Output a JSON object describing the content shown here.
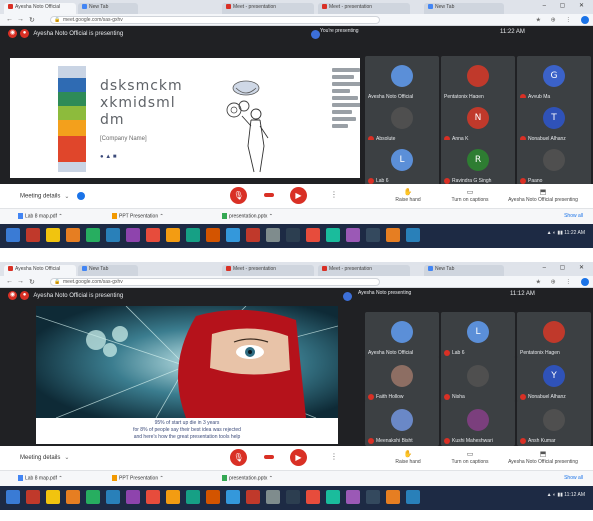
{
  "shots": [
    {
      "tabs": [
        {
          "label": "Ayesha Noto Official",
          "color": "#d93025"
        },
        {
          "label": "New Tab",
          "color": "#4285f4"
        },
        {
          "label": "Meet - presentation",
          "color": "#d93025"
        },
        {
          "label": "Meet - presentation",
          "color": "#d93025"
        },
        {
          "label": "New Tab",
          "color": "#4285f4"
        }
      ],
      "url": "meet.google.com/sas-gxhv",
      "presenting_text": "Ayesha Noto Official is presenting",
      "top_info": "You're presenting",
      "clock": "11:22 AM",
      "slide": {
        "title_lines": [
          "dsksmckm",
          "xkmidsml",
          "dm"
        ],
        "company": "[Company Name]",
        "logo_text": "● ▲ ■"
      },
      "tiles": [
        {
          "initial": "",
          "name": "Ayesha Noto Official",
          "color": "#5b8fd8"
        },
        {
          "initial": "",
          "name": "Pentatonix Hagen",
          "color": "#c0392b"
        },
        {
          "initial": "G",
          "name": "Ayyub Ma",
          "color": "#3b62c9"
        },
        {
          "initial": "",
          "name": "Absolute",
          "color": "#4f4f4f"
        },
        {
          "initial": "N",
          "name": "Anna K",
          "color": "#c0392b"
        },
        {
          "initial": "T",
          "name": "Nonabuel Alhanz",
          "color": "#2f52b8"
        },
        {
          "initial": "L",
          "name": "Lab 6",
          "color": "#5b8fd8"
        },
        {
          "initial": "R",
          "name": "Ravindra G Singh",
          "color": "#2e7d32"
        },
        {
          "initial": "",
          "name": "Paano",
          "color": "#4f4f4f"
        }
      ],
      "meeting_details": "Meeting details",
      "actions": [
        {
          "icon": "✋",
          "label": "Raise hand"
        },
        {
          "icon": "▭",
          "label": "Turn on captions"
        },
        {
          "icon": "⬒",
          "label": "Ayesha Noto Official presenting"
        }
      ],
      "downloads": [
        {
          "name": "Lab 8 map.pdf",
          "kind": "pdf"
        },
        {
          "name": "PPT Presentation",
          "kind": "ppt"
        },
        {
          "name": "presentation.pptx",
          "kind": "xls"
        }
      ],
      "show_all": "Show all"
    },
    {
      "tabs": [
        {
          "label": "Ayesha Noto Official",
          "color": "#d93025"
        },
        {
          "label": "New Tab",
          "color": "#4285f4"
        },
        {
          "label": "Meet - presentation",
          "color": "#d93025"
        },
        {
          "label": "Meet - presentation",
          "color": "#d93025"
        },
        {
          "label": "New Tab",
          "color": "#4285f4"
        }
      ],
      "url": "meet.google.com/sas-gxhv",
      "presenting_text": "Ayesha Noto Official is presenting",
      "top_info": "Ayesha Noto presenting",
      "clock": "11:12 AM",
      "slide": {
        "caption_1": "95% of start up die in 3 years",
        "caption_2": "for 8% of people say their best idea was rejected",
        "caption_3": "and here's how the great presentation tools help"
      },
      "tiles": [
        {
          "initial": "",
          "name": "Ayesha Noto Official",
          "color": "#5b8fd8"
        },
        {
          "initial": "L",
          "name": "Lab 6",
          "color": "#5b8fd8"
        },
        {
          "initial": "",
          "name": "Pentatonix Hagen",
          "color": "#c0392b"
        },
        {
          "initial": "",
          "name": "Faith Hollow",
          "color": "#8d6e63"
        },
        {
          "initial": "",
          "name": "Nisha",
          "color": "#4f4f4f"
        },
        {
          "initial": "Y",
          "name": "Nonabuel Alhanz",
          "color": "#2f52b8"
        },
        {
          "initial": "",
          "name": "Meenakshi Bisht",
          "color": "#6a88c7"
        },
        {
          "initial": "",
          "name": "Kushi Maheshwari",
          "color": "#7b3f7d"
        },
        {
          "initial": "",
          "name": "Ansh Kumar",
          "color": "#4f4f4f"
        }
      ],
      "meeting_details": "Meeting details",
      "actions": [
        {
          "icon": "✋",
          "label": "Raise hand"
        },
        {
          "icon": "▭",
          "label": "Turn on captions"
        },
        {
          "icon": "⬒",
          "label": "Ayesha Noto Official presenting"
        }
      ],
      "downloads": [
        {
          "name": "Lab 8 map.pdf",
          "kind": "pdf"
        },
        {
          "name": "PPT Presentation",
          "kind": "ppt"
        },
        {
          "name": "presentation.pptx",
          "kind": "xls"
        }
      ],
      "show_all": "Show all"
    }
  ],
  "colors": {
    "accent_red": "#d93025",
    "meet_dark": "#202124",
    "tile_bg": "#3c4043",
    "taskbar": "#1d2a44"
  }
}
